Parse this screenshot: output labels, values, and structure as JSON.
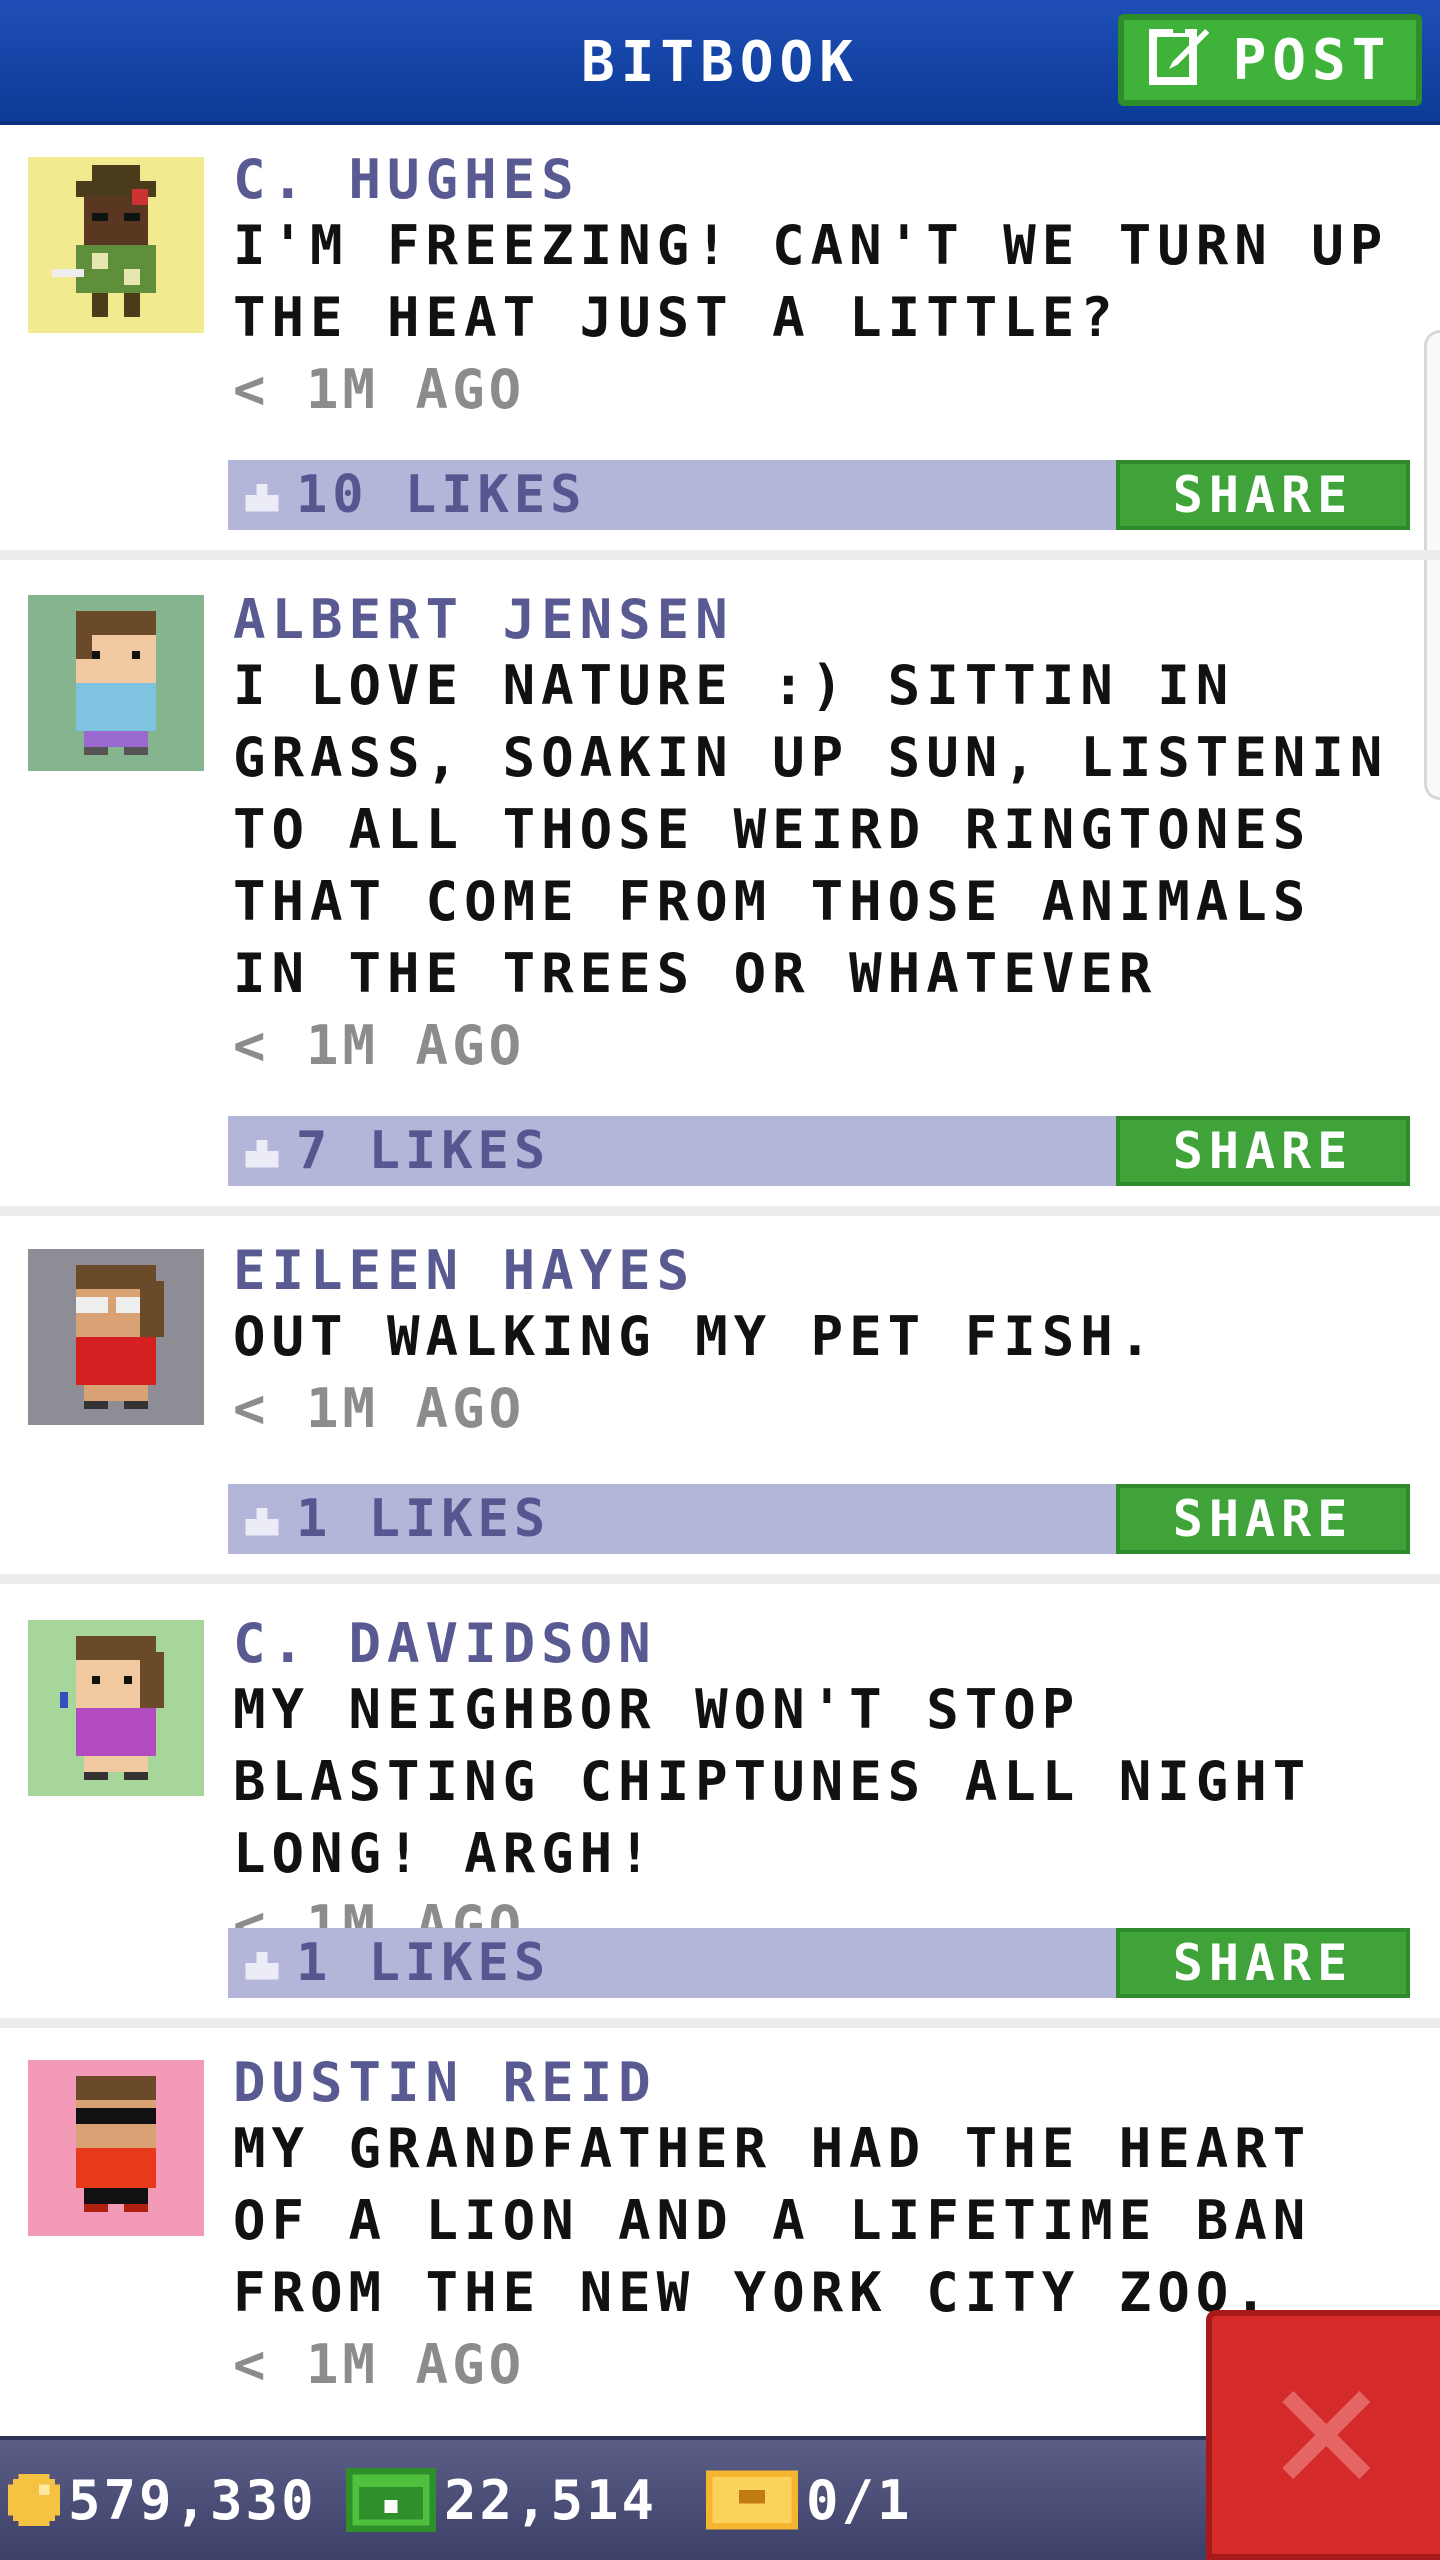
{
  "header": {
    "title": "BITBOOK",
    "post_label": "POST",
    "post_icon": "edit-icon"
  },
  "posts": [
    {
      "author": "C. HUGHES",
      "text": "I'M FREEZING! CAN'T WE TURN UP THE HEAT JUST A LITTLE?",
      "time": "< 1M AGO",
      "likes": "10 LIKES",
      "share_label": "SHARE",
      "avatar_bg": "#f1ea8f"
    },
    {
      "author": "ALBERT JENSEN",
      "text": "I LOVE NATURE :) SITTIN IN GRASS, SOAKIN UP SUN, LISTENIN TO ALL THOSE WEIRD RINGTONES THAT COME FROM THOSE ANIMALS IN THE TREES OR WHATEVER",
      "time": "< 1M AGO",
      "likes": "7 LIKES",
      "share_label": "SHARE",
      "avatar_bg": "#86b48f"
    },
    {
      "author": "EILEEN HAYES",
      "text": "OUT WALKING MY PET FISH.",
      "time": "< 1M AGO",
      "likes": "1 LIKES",
      "share_label": "SHARE",
      "avatar_bg": "#8e8c95"
    },
    {
      "author": "C. DAVIDSON",
      "text": "MY NEIGHBOR WON'T STOP BLASTING CHIPTUNES ALL NIGHT LONG! ARGH!",
      "time": "< 1M AGO",
      "likes": "1 LIKES",
      "share_label": "SHARE",
      "avatar_bg": "#a7d69a"
    },
    {
      "author": "DUSTIN REID",
      "text": "MY GRANDFATHER HAD THE HEART OF A LION AND A LIFETIME BAN FROM THE NEW YORK CITY ZOO.",
      "time": "< 1M AGO",
      "likes": "",
      "share_label": "",
      "avatar_bg": "#f39ab8"
    }
  ],
  "bottom_bar": {
    "coins": "579,330",
    "bux": "22,514",
    "tickets": "0/1"
  },
  "colors": {
    "header": "#0b3a97",
    "green": "#3fa33a",
    "like_bar": "#b3b6d9",
    "author": "#5a5a92",
    "close": "#d42a2a"
  }
}
